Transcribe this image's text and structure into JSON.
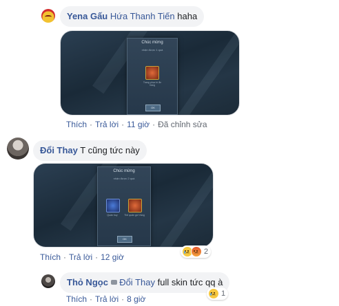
{
  "comments": [
    {
      "author": "Yena Gấu",
      "mention": "Hứa Thanh Tiến",
      "text": "haha",
      "dialog_title": "Chúc mừng",
      "dialog_subtitle": "nhận được 1 quà",
      "items": [
        {
          "label": "Trang phục bí ẩn Vàng"
        }
      ],
      "ok": "OK",
      "actions": {
        "like": "Thích",
        "reply": "Trả lời",
        "time": "11 giờ",
        "edited": "Đã chỉnh sửa"
      }
    },
    {
      "author": "Đổi Thay",
      "text": "T cũng tức này",
      "dialog_title": "Chúc mừng",
      "dialog_subtitle": "nhận được 2 quà",
      "items": [
        {
          "label": "Quân huy"
        },
        {
          "label": "Thẻ quân gói Vàng"
        }
      ],
      "ok": "OK",
      "actions": {
        "like": "Thích",
        "reply": "Trả lời",
        "time": "12 giờ"
      },
      "reactions": {
        "types": [
          "sad",
          "angry"
        ],
        "count": "2"
      }
    },
    {
      "author": "Thỏ Ngọc",
      "badge_icon": "speech-bubble-icon",
      "mention": "Đổi Thay",
      "text": "full skin tức qq à",
      "actions": {
        "like": "Thích",
        "reply": "Trả lời",
        "time": "8 giờ"
      },
      "reactions": {
        "types": [
          "sad"
        ],
        "count": "1"
      }
    }
  ],
  "colors": {
    "link": "#385898",
    "meta": "#616770",
    "bubble": "#f2f3f5"
  }
}
